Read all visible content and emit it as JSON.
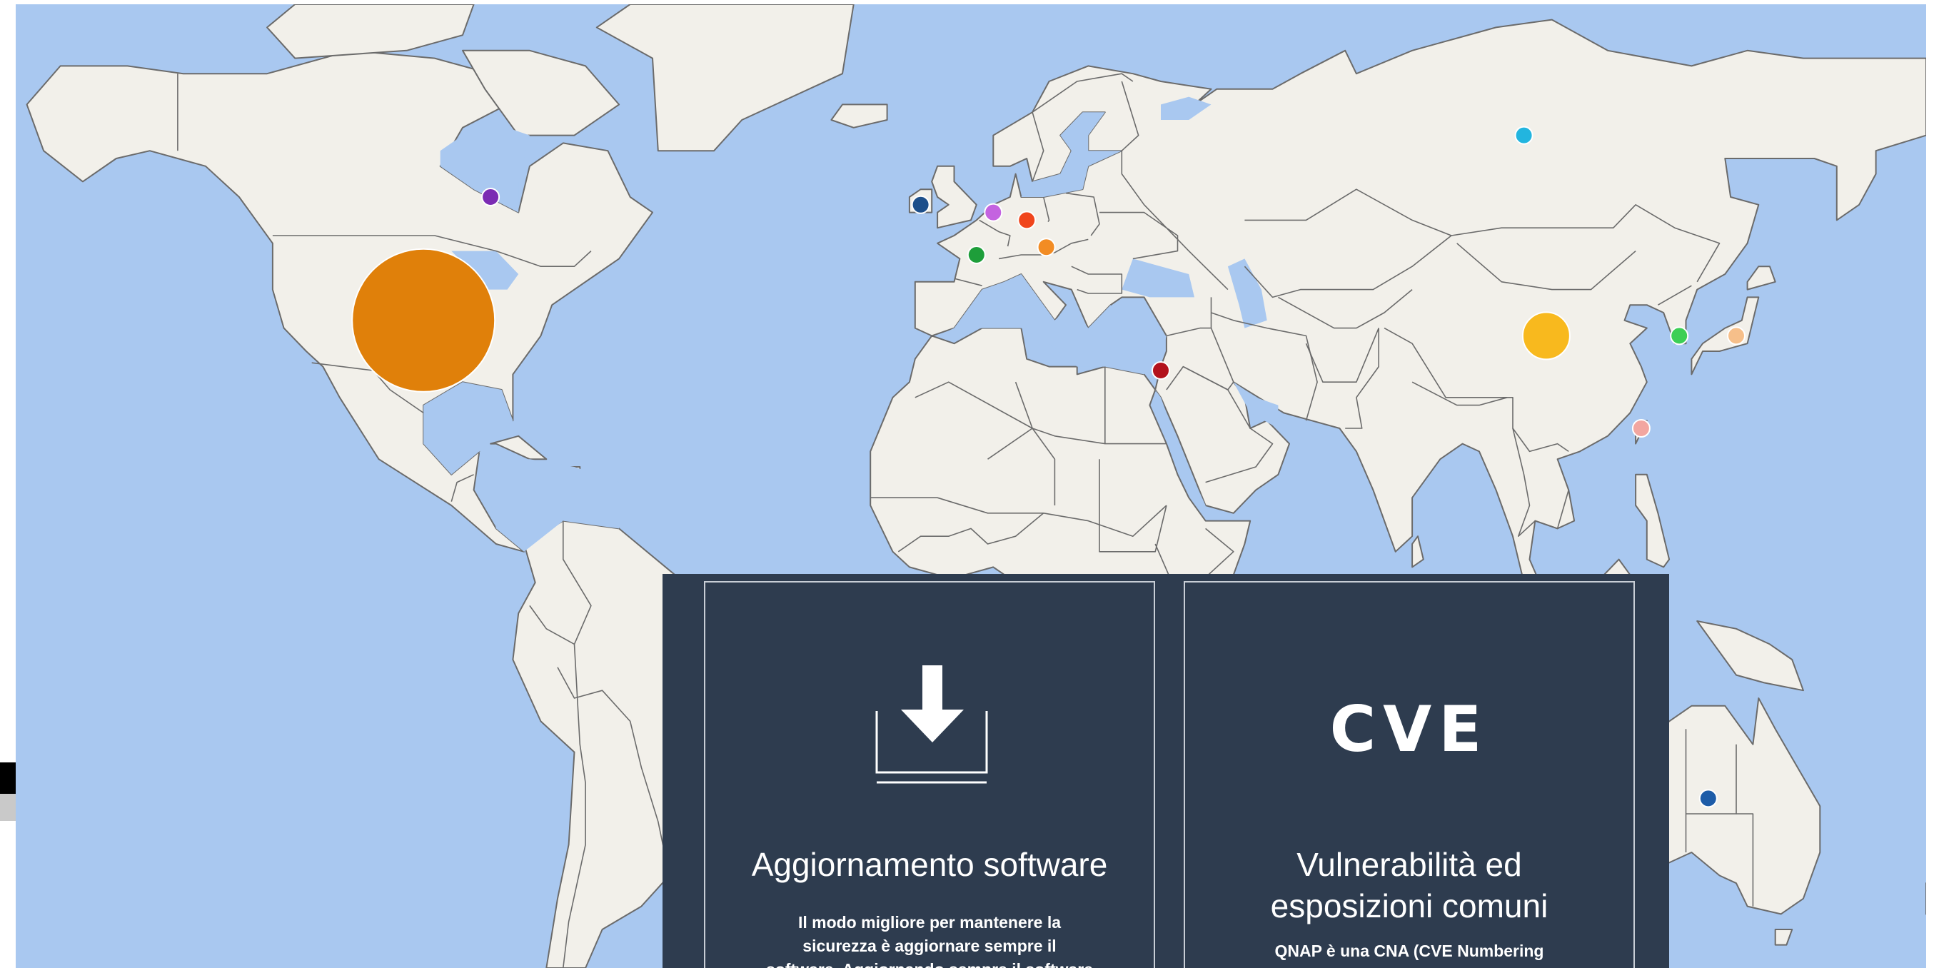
{
  "colors": {
    "ocean": "#a9c8f0",
    "land": "#f2f0ea",
    "border": "#6b6b6b",
    "panel": "#2e3c4f",
    "card_border": "#c8ced6",
    "text": "#ffffff"
  },
  "markers": [
    {
      "name": "canada",
      "lon": -85,
      "lat": 54,
      "color": "#7b2bb3",
      "size": "small"
    },
    {
      "name": "united-states",
      "lon": -97,
      "lat": 38,
      "color": "#e0800a",
      "size": "very-large"
    },
    {
      "name": "ireland",
      "lon": -8,
      "lat": 53,
      "color": "#1d4f8a",
      "size": "small"
    },
    {
      "name": "netherlands",
      "lon": 5,
      "lat": 52,
      "color": "#c463e0",
      "size": "small"
    },
    {
      "name": "germany",
      "lon": 11,
      "lat": 51,
      "color": "#f0451c",
      "size": "small"
    },
    {
      "name": "france",
      "lon": 2,
      "lat": 46.5,
      "color": "#1e9e3a",
      "size": "small"
    },
    {
      "name": "austria",
      "lon": 14.5,
      "lat": 47.5,
      "color": "#f28c24",
      "size": "small"
    },
    {
      "name": "israel",
      "lon": 35,
      "lat": 31.5,
      "color": "#b3121c",
      "size": "small"
    },
    {
      "name": "russia",
      "lon": 100,
      "lat": 62,
      "color": "#22b5df",
      "size": "small"
    },
    {
      "name": "china",
      "lon": 104,
      "lat": 36,
      "color": "#f8b91e",
      "size": "medium"
    },
    {
      "name": "south-korea",
      "lon": 127.8,
      "lat": 36,
      "color": "#3ccf55",
      "size": "small"
    },
    {
      "name": "japan",
      "lon": 138,
      "lat": 36,
      "color": "#f6bf8a",
      "size": "small"
    },
    {
      "name": "taiwan",
      "lon": 121,
      "lat": 24,
      "color": "#f2a6a0",
      "size": "small"
    },
    {
      "name": "australia",
      "lon": 133,
      "lat": -24,
      "color": "#1d5ca8",
      "size": "small"
    }
  ],
  "cards": [
    {
      "icon": "download-icon",
      "title": "Aggiornamento software",
      "text_lines": [
        "Il modo migliore per mantenere la",
        "sicurezza è aggiornare sempre il",
        "software. Aggiornando sempre il software"
      ]
    },
    {
      "icon": "cve-logo",
      "logo_text": "CVE",
      "title_lines": [
        "Vulnerabilità ed",
        "esposizioni comuni"
      ],
      "text_lines": [
        "QNAP è una CNA (CVE Numbering"
      ]
    }
  ]
}
